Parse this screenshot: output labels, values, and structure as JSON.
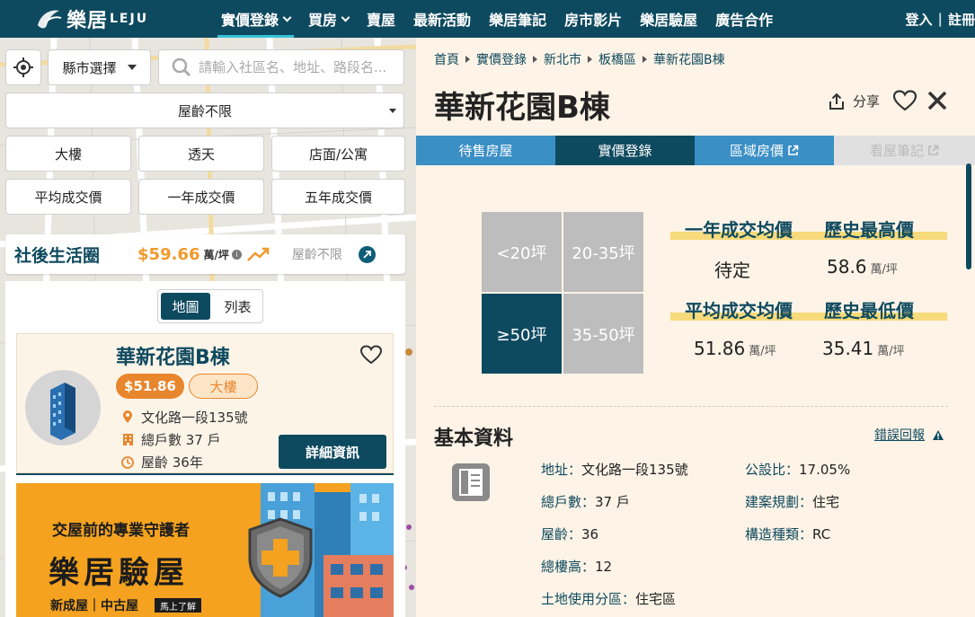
{
  "header": {
    "logo_text": "樂居",
    "logo_sub": "LEJU",
    "nav": [
      {
        "label": "實價登錄",
        "dropdown": true,
        "active": true
      },
      {
        "label": "買房",
        "dropdown": true,
        "active": false
      },
      {
        "label": "賣屋",
        "dropdown": false,
        "active": false
      },
      {
        "label": "最新活動",
        "dropdown": false,
        "active": false
      },
      {
        "label": "樂居筆記",
        "dropdown": false,
        "active": false
      },
      {
        "label": "房市影片",
        "dropdown": false,
        "active": false
      },
      {
        "label": "樂居驗屋",
        "dropdown": false,
        "active": false
      },
      {
        "label": "廣告合作",
        "dropdown": false,
        "active": false
      }
    ],
    "login": "登入",
    "divider": "|",
    "register": "註冊"
  },
  "map_panel": {
    "city_select": "縣市選擇",
    "search_placeholder": "請輸入社區名、地址、路段名...",
    "age_select": "屋齡不限",
    "filters_row1": [
      "大樓",
      "透天",
      "店面/公寓"
    ],
    "filters_row2": [
      "平均成交價",
      "一年成交價",
      "五年成交價"
    ],
    "community": {
      "name": "社後生活圈",
      "price": "$59.66",
      "unit": "萬/坪",
      "age": "屋齡不限"
    },
    "view_toggle": [
      "地圖",
      "列表"
    ],
    "card": {
      "title": "華新花園B棟",
      "price": "$51.86",
      "type": "大樓",
      "address": "文化路一段135號",
      "households": "總戶數 37 戶",
      "age": "屋齡 36年",
      "detail_button": "詳細資訊"
    },
    "banner": {
      "subtitle": "交屋前的專業守護者",
      "title": "樂居驗屋",
      "footer": "新成屋｜中古屋",
      "cta": "馬上了解"
    }
  },
  "detail_panel": {
    "breadcrumb": [
      "首頁",
      "實價登錄",
      "新北市",
      "板橋區",
      "華新花園B棟"
    ],
    "title": "華新花園B棟",
    "share_label": "分享",
    "tabs": [
      "待售房屋",
      "實價登錄",
      "區域房價",
      "看屋筆記"
    ],
    "size_buttons": [
      "<20坪",
      "20-35坪",
      "≥50坪",
      "35-50坪"
    ],
    "stats": {
      "one_year_avg_label": "一年成交均價",
      "one_year_avg_value": "待定",
      "hist_high_label": "歷史最高價",
      "hist_high_value": "58.6",
      "avg_label": "平均成交均價",
      "avg_value": "51.86",
      "hist_low_label": "歷史最低價",
      "hist_low_value": "35.41",
      "unit": "萬/坪"
    },
    "basic_info": {
      "section_title": "基本資料",
      "report_link": "錯誤回報",
      "address": {
        "k": "地址：",
        "v": "文化路一段135號"
      },
      "households": {
        "k": "總戶數：",
        "v": "37 戶"
      },
      "age": {
        "k": "屋齡：",
        "v": "36"
      },
      "floors": {
        "k": "總樓高：",
        "v": "12"
      },
      "land_use": {
        "k": "土地使用分區：",
        "v": "住宅區"
      },
      "public_ratio": {
        "k": "公設比：",
        "v": "17.05%"
      },
      "planning": {
        "k": "建案規劃：",
        "v": "住宅"
      },
      "structure": {
        "k": "構造種類：",
        "v": "RC"
      }
    }
  },
  "colors": {
    "brand": "#0e4a5f",
    "tab_blue": "#3a8fc5",
    "orange": "#e8862d",
    "highlight": "#f7da7a",
    "panel_bg": "#fdf3e6"
  }
}
